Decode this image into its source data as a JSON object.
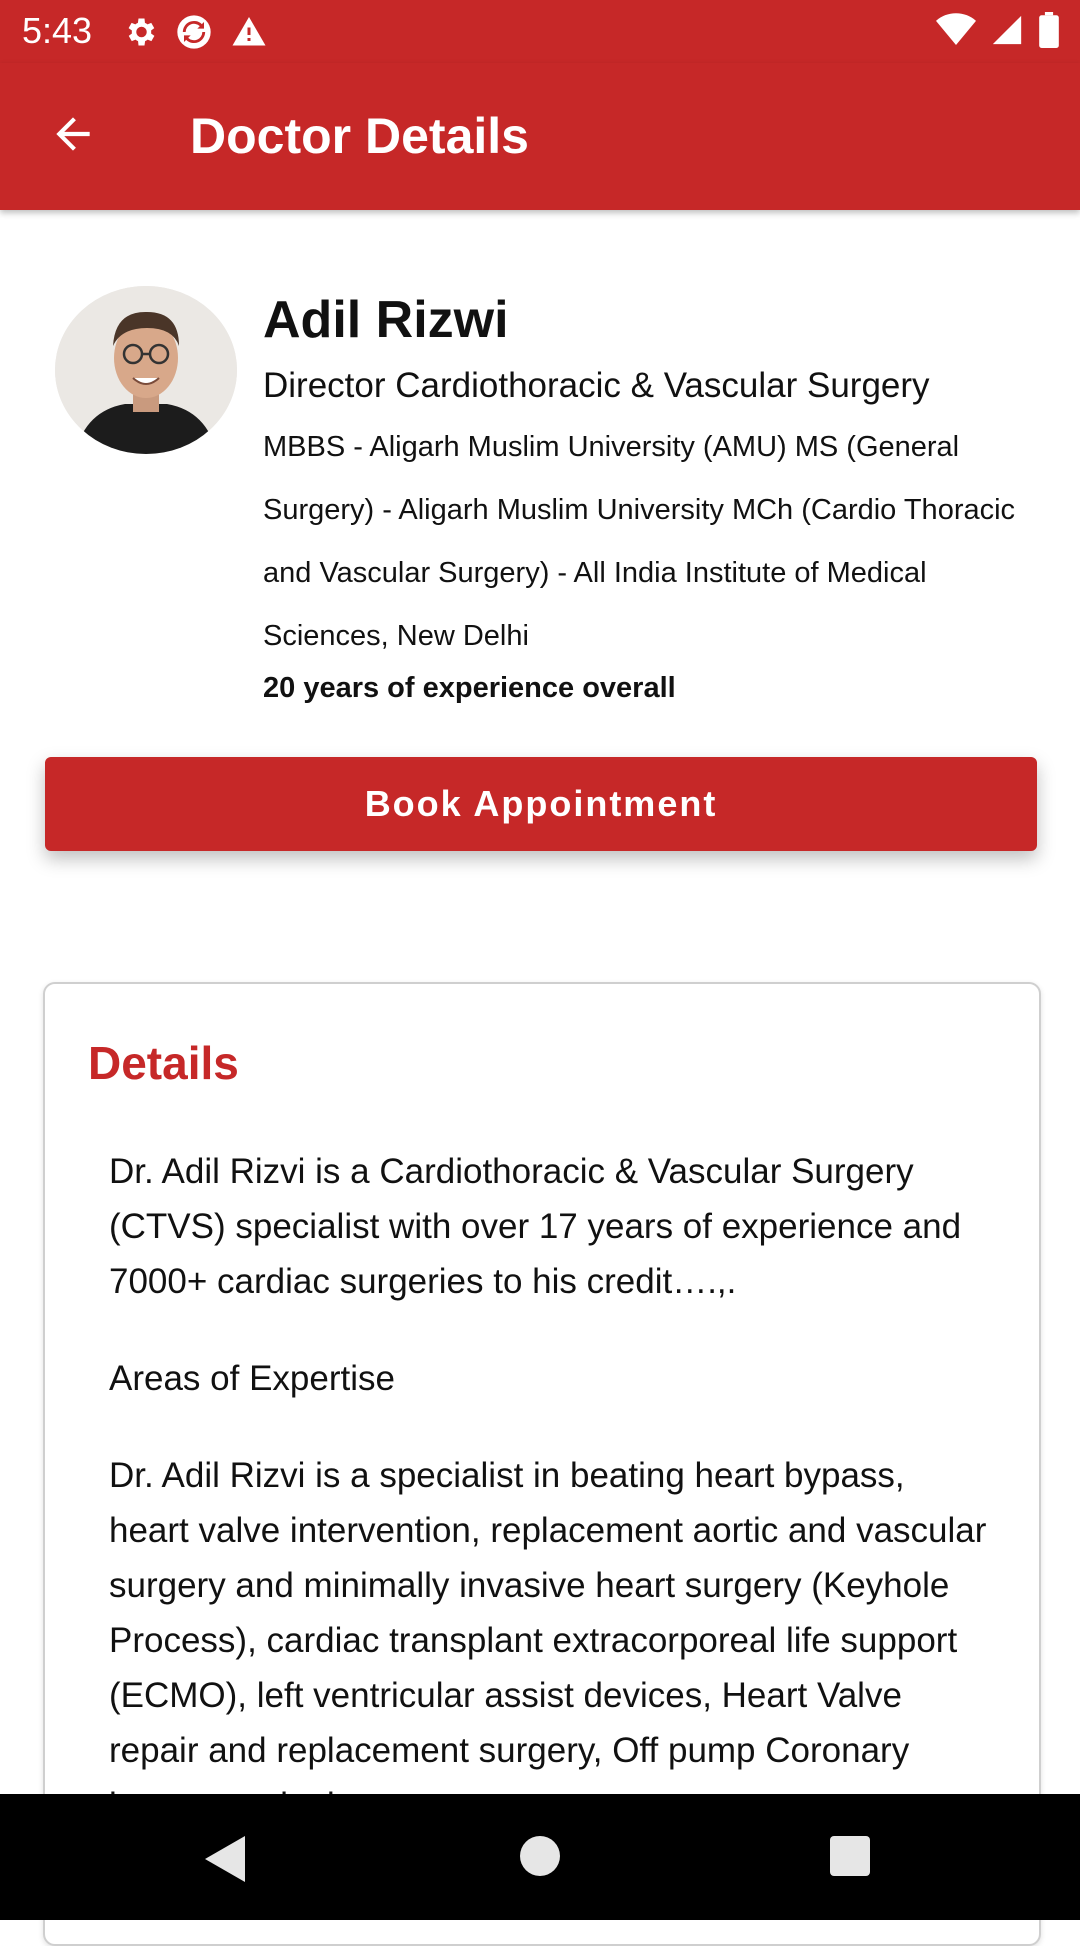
{
  "status_bar": {
    "time": "5:43",
    "icons_left": [
      "gear-icon",
      "sync-icon",
      "warning-icon"
    ],
    "icons_right": [
      "wifi-icon",
      "signal-icon",
      "battery-icon"
    ]
  },
  "app_bar": {
    "title": "Doctor Details",
    "back_icon": "arrow-back-icon"
  },
  "doctor": {
    "name": "Adil Rizwi",
    "designation": "Director Cardiothoracic & Vascular Surgery",
    "qualifications": "MBBS - Aligarh Muslim University (AMU) MS (General Surgery) - Aligarh Muslim University MCh (Cardio Thoracic and Vascular Surgery) - All India Institute of Medical Sciences, New Delhi",
    "experience": "20 years of experience overall"
  },
  "book_button": {
    "label": "Book Appointment"
  },
  "details": {
    "heading": "Details",
    "paragraphs": [
      "Dr. Adil Rizvi is a Cardiothoracic & Vascular Surgery (CTVS) specialist with over 17 years of experience and 7000+ cardiac surgeries to his credit….,.",
      "Areas of Expertise",
      "Dr. Adil Rizvi is a specialist in beating heart bypass, heart valve intervention, replacement aortic and vascular surgery and minimally invasive heart surgery (Keyhole Process), cardiac transplant extracorporeal life support (ECMO), left ventricular assist devices, Heart Valve repair and replacement surgery, Off pump Coronary bypass and other"
    ]
  },
  "nav_bar": {
    "icons": [
      "nav-back-icon",
      "nav-home-icon",
      "nav-recents-icon"
    ]
  },
  "colors": {
    "primary": "#c62828",
    "text": "#111111"
  }
}
